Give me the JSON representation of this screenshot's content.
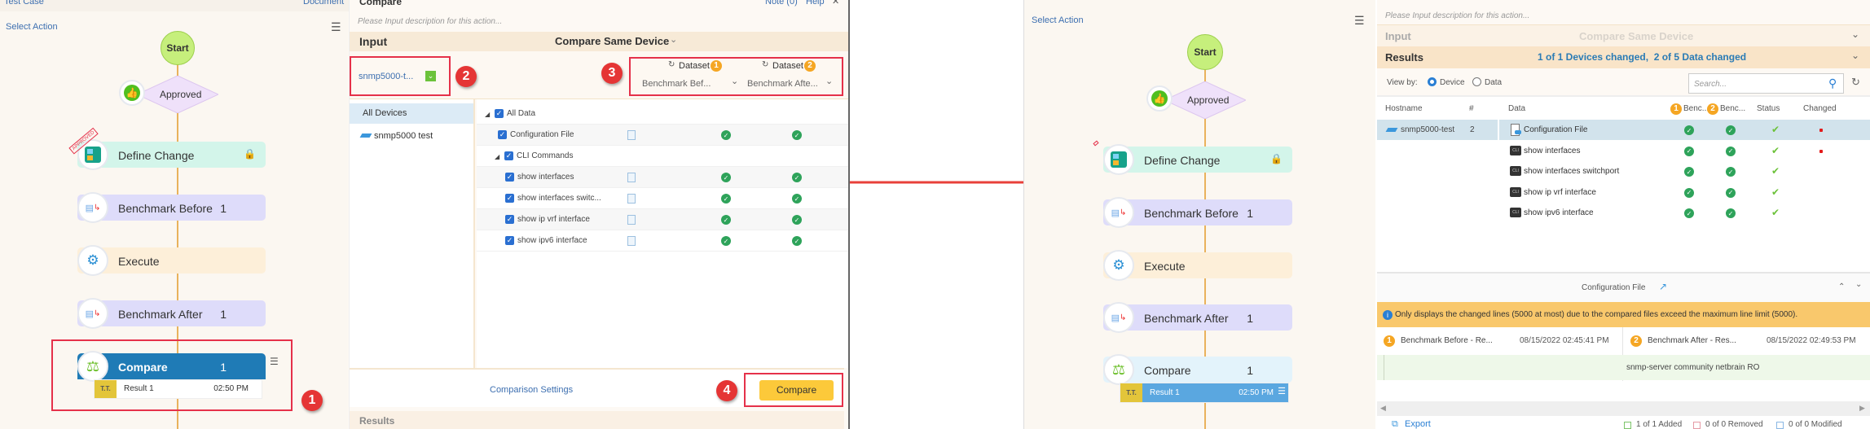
{
  "left_window": {
    "top_bar": {
      "test_case": "Test Case",
      "document": "Document"
    },
    "flow": {
      "select_action": "Select Action",
      "start": "Start",
      "approved": "Approved",
      "approved_stamp": "APPROVED",
      "nodes": [
        {
          "label": "Define Change",
          "count": "",
          "icon": "define-change-icon",
          "color": "#d3f5ea"
        },
        {
          "label": "Benchmark Before",
          "count": "1",
          "icon": "benchmark-icon",
          "color": "#dedcfa"
        },
        {
          "label": "Execute",
          "count": "",
          "icon": "gears-icon",
          "color": "#fdefd9"
        },
        {
          "label": "Benchmark After",
          "count": "1",
          "icon": "benchmark-icon",
          "color": "#dedcfa"
        },
        {
          "label": "Compare",
          "count": "1",
          "icon": "scale-icon",
          "color": "#1f7bb6"
        }
      ],
      "result": {
        "label": "Result 1",
        "time": "02:50 PM"
      }
    },
    "compare": {
      "title": "Compare",
      "note": "Note (0)",
      "help": "Help",
      "close": "✕",
      "description_placeholder": "Please Input description for this action...",
      "input_label": "Input",
      "mode": "Compare Same Device",
      "device_selector": "snmp5000-t...",
      "datasets": [
        {
          "label": "Dataset",
          "badge": "1",
          "value": "Benchmark Bef..."
        },
        {
          "label": "Dataset",
          "badge": "2",
          "value": "Benchmark Afte..."
        }
      ],
      "device_list": {
        "all": "All Devices",
        "items": [
          "snmp5000 test"
        ]
      },
      "tree": [
        {
          "label": "All Data",
          "level": 0,
          "expander": true,
          "checks": false
        },
        {
          "label": "Configuration File",
          "level": 1,
          "expander": false,
          "checks": true
        },
        {
          "label": "CLI Commands",
          "level": 1,
          "expander": true,
          "checks": false
        },
        {
          "label": "show interfaces",
          "level": 2,
          "expander": false,
          "checks": true
        },
        {
          "label": "show interfaces switc...",
          "level": 2,
          "expander": false,
          "checks": true
        },
        {
          "label": "show ip vrf interface",
          "level": 2,
          "expander": false,
          "checks": true
        },
        {
          "label": "show ipv6 interface",
          "level": 2,
          "expander": false,
          "checks": true
        }
      ],
      "comparison_settings": "Comparison Settings",
      "compare_button": "Compare",
      "results_label": "Results"
    },
    "annotations": [
      "1",
      "2",
      "3",
      "4"
    ]
  },
  "right_window": {
    "flow": {
      "select_action": "Select Action",
      "start": "Start",
      "approved": "Approved",
      "nodes": [
        {
          "label": "Define Change",
          "count": "",
          "icon": "define-change-icon",
          "color": "#d3f5ea"
        },
        {
          "label": "Benchmark Before",
          "count": "1",
          "icon": "benchmark-icon",
          "color": "#dedcfa"
        },
        {
          "label": "Execute",
          "count": "",
          "icon": "gears-icon",
          "color": "#fdefd9"
        },
        {
          "label": "Benchmark After",
          "count": "1",
          "icon": "benchmark-icon",
          "color": "#dedcfa"
        },
        {
          "label": "Compare",
          "count": "1",
          "icon": "scale-icon",
          "color": "#e3f3fb"
        }
      ],
      "result": {
        "label": "Result 1",
        "time": "02:50 PM"
      }
    },
    "results": {
      "description_placeholder": "Please Input description for this action...",
      "input_label": "Input",
      "mode": "Compare Same Device",
      "results_label": "Results",
      "summary": "1 of 1 Devices changed,  2 of 5 Data changed",
      "view_by_label": "View by:",
      "view_options": [
        {
          "label": "Device",
          "selected": true
        },
        {
          "label": "Data",
          "selected": false
        }
      ],
      "search_placeholder": "Search...",
      "columns": {
        "hostname": "Hostname",
        "count": "#",
        "data": "Data",
        "bench1": "Benc...",
        "bench2": "Benc...",
        "status": "Status",
        "changed": "Changed",
        "badge1": "1",
        "badge2": "2"
      },
      "hostname": "snmp5000-test",
      "host_count": "2",
      "rows": [
        {
          "data": "Configuration File",
          "icon": "config-file-icon",
          "changed": true
        },
        {
          "data": "show interfaces",
          "icon": "cli-icon",
          "changed": true
        },
        {
          "data": "show interfaces switchport",
          "icon": "cli-icon",
          "changed": false
        },
        {
          "data": "show ip vrf interface",
          "icon": "cli-icon",
          "changed": false
        },
        {
          "data": "show ipv6 interface",
          "icon": "cli-icon",
          "changed": false
        }
      ],
      "detail": {
        "title": "Configuration File",
        "banner": "Only displays the changed lines (5000 at most) due to the compared files exceed the maximum line limit (5000).",
        "left": {
          "badge": "1",
          "name": "Benchmark Before - Re...",
          "date": "08/15/2022 02:45:41 PM",
          "line": ""
        },
        "right": {
          "badge": "2",
          "name": "Benchmark After - Res...",
          "date": "08/15/2022 02:49:53 PM",
          "line": "snmp-server community netbrain RO"
        },
        "export": "Export",
        "legend": [
          "1 of 1 Added",
          "0 of 0 Removed",
          "0 of 0 Modified"
        ]
      }
    }
  },
  "colors": {
    "accent_red": "#e5314a",
    "orange": "#f5a623",
    "green": "#2ea35a",
    "blue": "#1f7bb6"
  }
}
